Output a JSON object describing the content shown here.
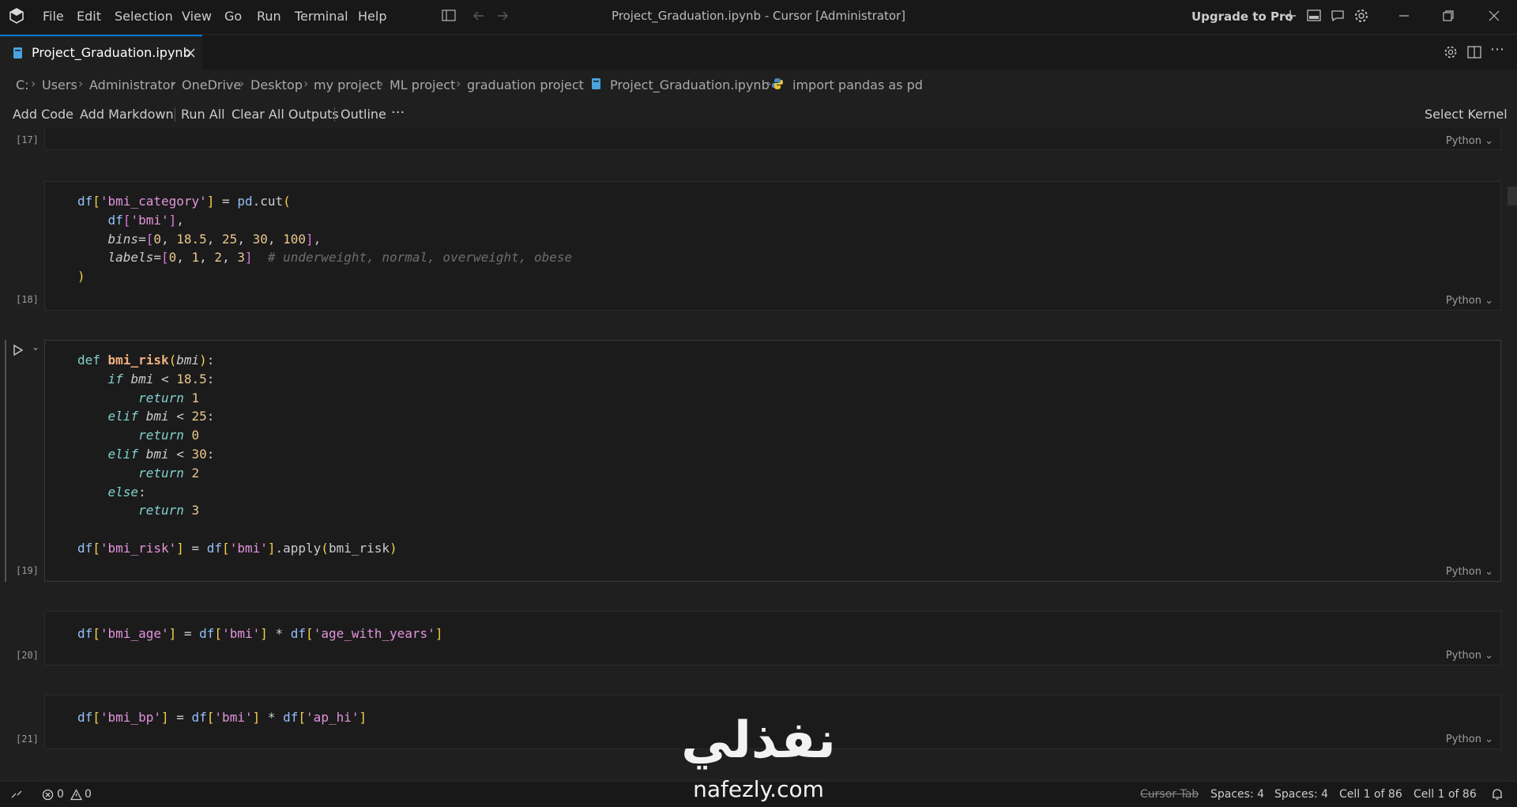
{
  "titlebar": {
    "menu": [
      "File",
      "Edit",
      "Selection",
      "View",
      "Go",
      "Run",
      "Terminal",
      "Help"
    ],
    "title": "Project_Graduation.ipynb - Cursor [Administrator]",
    "upgrade_label": "Upgrade to Pro"
  },
  "tabs": [
    {
      "label": "Project_Graduation.ipynb",
      "active": true
    }
  ],
  "breadcrumb": [
    "C:",
    "Users",
    "Administrator",
    "OneDrive",
    "Desktop",
    "my project",
    "ML project",
    "graduation project",
    "Project_Graduation.ipynb",
    "import pandas as pd"
  ],
  "toolbar": {
    "add_code": "Add Code",
    "add_markdown": "Add Markdown",
    "run_all": "Run All",
    "clear_outputs": "Clear All Outputs",
    "outline": "Outline",
    "more": "···",
    "select_kernel": "Select Kernel"
  },
  "cells": [
    {
      "count": "[17]",
      "language": "Python"
    },
    {
      "count": "[18]",
      "language": "Python"
    },
    {
      "count": "[19]",
      "language": "Python"
    },
    {
      "count": "[20]",
      "language": "Python"
    },
    {
      "count": "[21]",
      "language": "Python"
    }
  ],
  "statusbar": {
    "errors": "0",
    "warnings": "0",
    "cursor_tab": "Cursor Tab",
    "spaces1": "Spaces: 4",
    "spaces2": "Spaces: 4",
    "cell1": "Cell 1 of 86",
    "cell2": "Cell 1 of 86"
  },
  "watermark": {
    "arabic": "نفذلي",
    "latin": "nafezly.com"
  },
  "colors": {
    "accent": "#0078d4",
    "background": "#1f1f1f",
    "keyword": "#82d2ce",
    "string": "#e394dc",
    "number": "#ebc88d"
  }
}
